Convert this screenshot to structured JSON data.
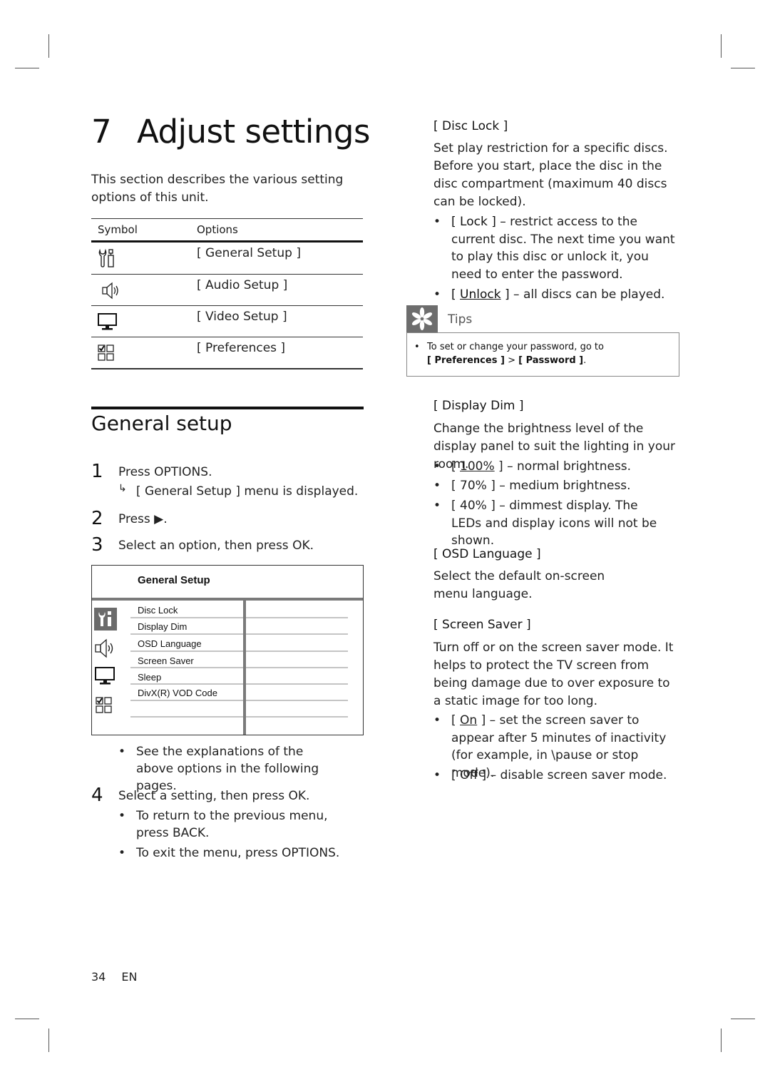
{
  "chapter": {
    "number": "7",
    "title": "Adjust settings",
    "intro": "This section describes the various setting options of this unit."
  },
  "symbol_table": {
    "headers": [
      "Symbol",
      "Options"
    ],
    "rows": [
      {
        "icon": "general-setup-icon",
        "option": "[ General Setup ]"
      },
      {
        "icon": "audio-setup-icon",
        "option": "[ Audio Setup ]"
      },
      {
        "icon": "video-setup-icon",
        "option": "[ Video Setup ]"
      },
      {
        "icon": "preferences-icon",
        "option": "[ Preferences ]"
      }
    ]
  },
  "general_setup": {
    "title": "General setup",
    "steps": [
      {
        "num": "1",
        "text": "Press OPTIONS.",
        "result": "[ General Setup ] menu is displayed.",
        "result_arrow": "↳"
      },
      {
        "num": "2",
        "text": "Press ▶."
      },
      {
        "num": "3",
        "text": "Select an option, then press OK."
      },
      {
        "num": "4",
        "text": "Select a setting, then press OK."
      }
    ],
    "step3_bullets": [
      "See the explanations of the above options in the following pages."
    ],
    "step4_bullets": [
      "To return to the previous menu, press BACK.",
      "To exit the menu, press OPTIONS."
    ],
    "bullet_char": "•"
  },
  "menu_screenshot": {
    "title": "General Setup",
    "items": [
      "Disc Lock",
      "Display Dim",
      "OSD Language",
      "Screen Saver",
      "Sleep",
      "DivX(R) VOD Code"
    ],
    "icons": [
      "general-setup-icon",
      "audio-setup-icon",
      "video-setup-icon",
      "preferences-icon"
    ],
    "selected_icon": "general-setup-icon"
  },
  "disc_lock": {
    "heading": "[ Disc Lock ]",
    "description": "Set play restriction for a specific discs. Before you start, place the disc in the disc compartment (maximum 40 discs can be locked).",
    "options": [
      {
        "label": "[ Lock ]",
        "desc": "– restrict access to the current disc.  The next time you want to play this disc or unlock it, you need to enter the password.",
        "default": false
      },
      {
        "label": "[ Unlock ]",
        "desc": "– all discs can be played.",
        "default": true
      }
    ]
  },
  "tips": {
    "label": "Tips",
    "text": "To set or change your password, go to",
    "path_part1": "[ Preferences ]",
    "path_sep": ">",
    "path_part2": "[ Password ]",
    "path_end": "."
  },
  "display_dim": {
    "heading": "[ Display Dim ]",
    "description": "Change the brightness level of the display panel to suit the lighting in your room.",
    "options": [
      {
        "label": "100%",
        "desc": "– normal brightness.",
        "default": true
      },
      {
        "label": "70%",
        "desc": "– medium brightness.",
        "default": false
      },
      {
        "label": "40%",
        "desc": "– dimmest display. The LEDs and display icons will not be shown.",
        "default": false
      }
    ]
  },
  "osd_language": {
    "heading": "[ OSD Language ]",
    "description": "Select the default on-screen menu language."
  },
  "screen_saver": {
    "heading": "[ Screen Saver ]",
    "description": "Turn off or on the screen saver mode.  It helps to protect the TV screen from being damage due to over exposure to a static image for too long.",
    "options": [
      {
        "label": "On",
        "desc": "– set the screen saver to appear after 5 minutes of inactivity (for example, in \\pause or stop mode).",
        "default": true
      },
      {
        "label": "Off",
        "desc": "– disable screen saver mode.",
        "default": false
      }
    ]
  },
  "footer": {
    "page_number": "34",
    "language": "EN"
  },
  "colors": {
    "text": "#1a1a1a",
    "menu_bar_gray": "#7a7a7a",
    "tips_icon_bg": "#6d6d6d"
  }
}
